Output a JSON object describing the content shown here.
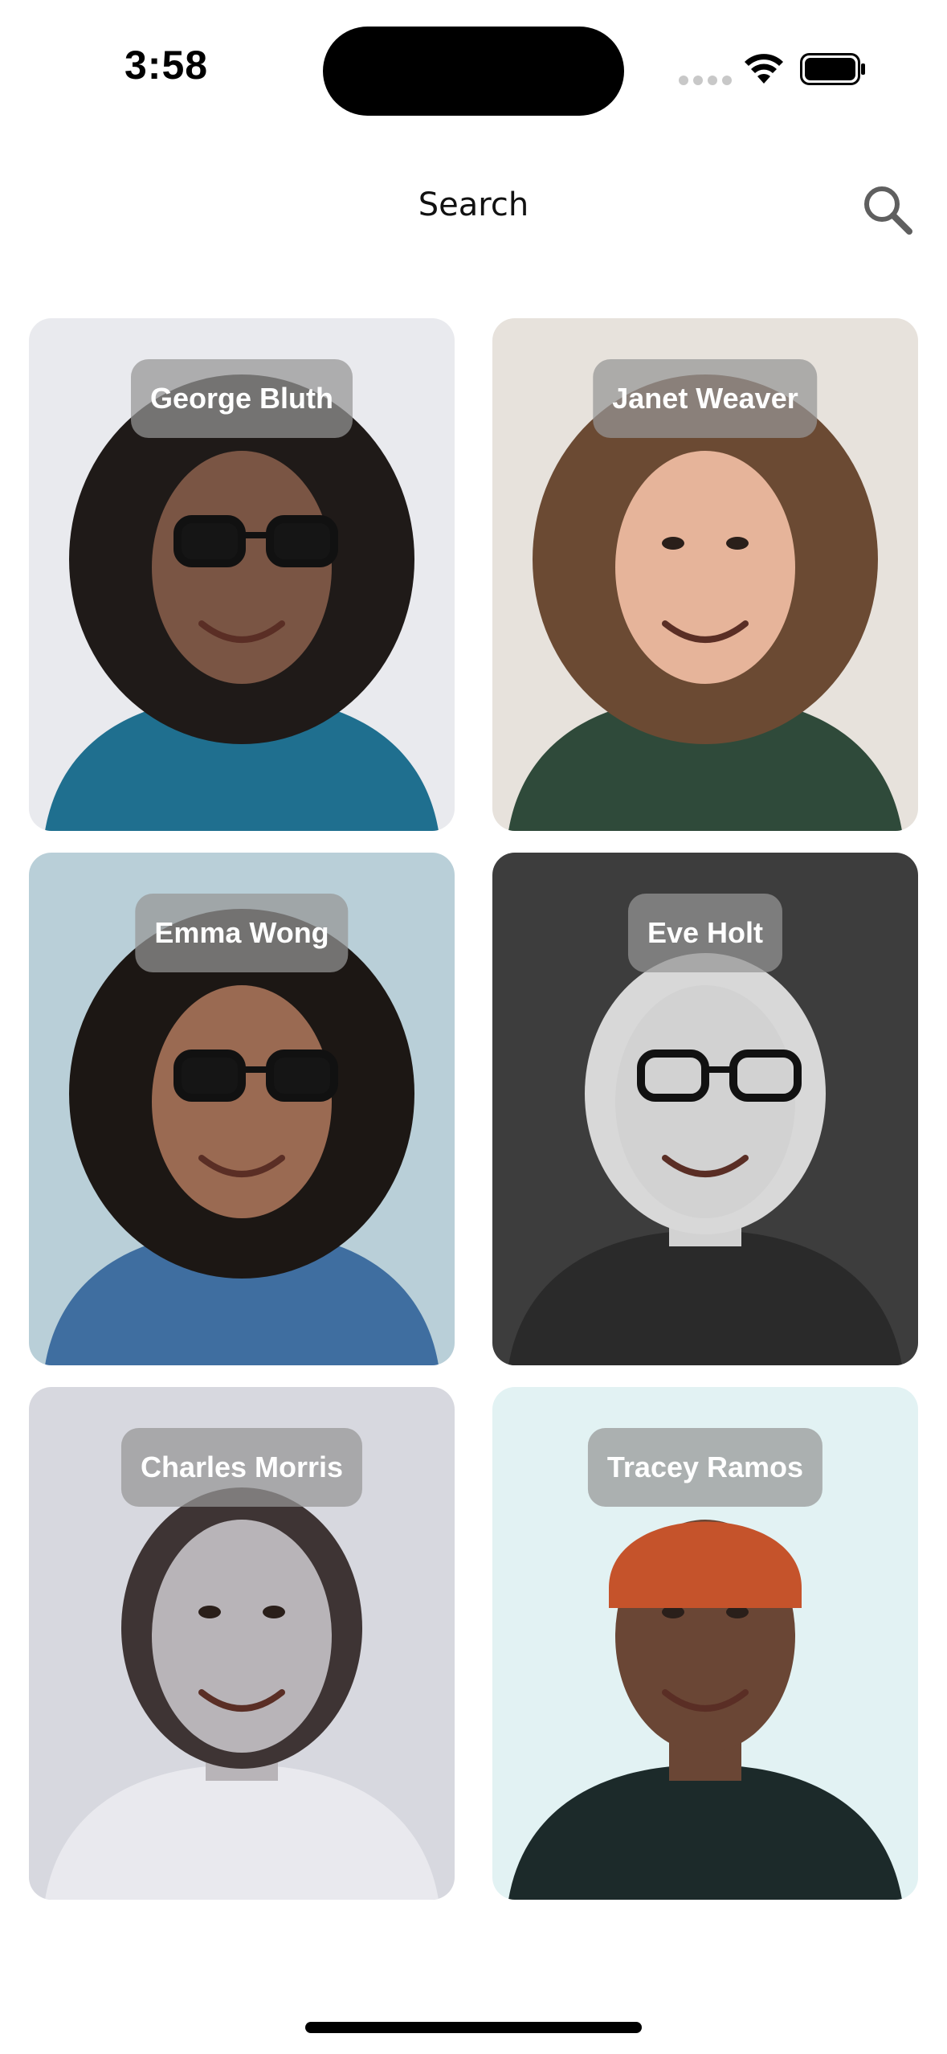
{
  "status_bar": {
    "time": "3:58"
  },
  "header": {
    "title": "Search",
    "search_icon": "magnifier-icon"
  },
  "contacts": [
    {
      "name": "George Bluth",
      "bg": "#e9eaee",
      "skin": "#7a5544",
      "hair": "#1f1a18",
      "shirt": "#1f6f8f",
      "accessory": "sunglasses"
    },
    {
      "name": "Janet Weaver",
      "bg": "#e7e2dc",
      "skin": "#e6b49a",
      "hair": "#6b4a33",
      "shirt": "#2f4a3a",
      "accessory": "none"
    },
    {
      "name": "Emma Wong",
      "bg": "#b9cfd8",
      "skin": "#9a6a52",
      "hair": "#1c1714",
      "shirt": "#3f6ea0",
      "accessory": "sunglasses"
    },
    {
      "name": "Eve Holt",
      "bg": "#3d3d3d",
      "skin": "#d2d2d2",
      "hair": "#d8d8d8",
      "shirt": "#2a2a2a",
      "accessory": "glasses"
    },
    {
      "name": "Charles Morris",
      "bg": "#d7d8df",
      "skin": "#b8b4b8",
      "hair": "#3e3434",
      "shirt": "#e9e9ee",
      "accessory": "none"
    },
    {
      "name": "Tracey Ramos",
      "bg": "#e2f2f3",
      "skin": "#6a4635",
      "hair": "#c5532b",
      "shirt": "#1c2a2a",
      "accessory": "beanie"
    }
  ]
}
